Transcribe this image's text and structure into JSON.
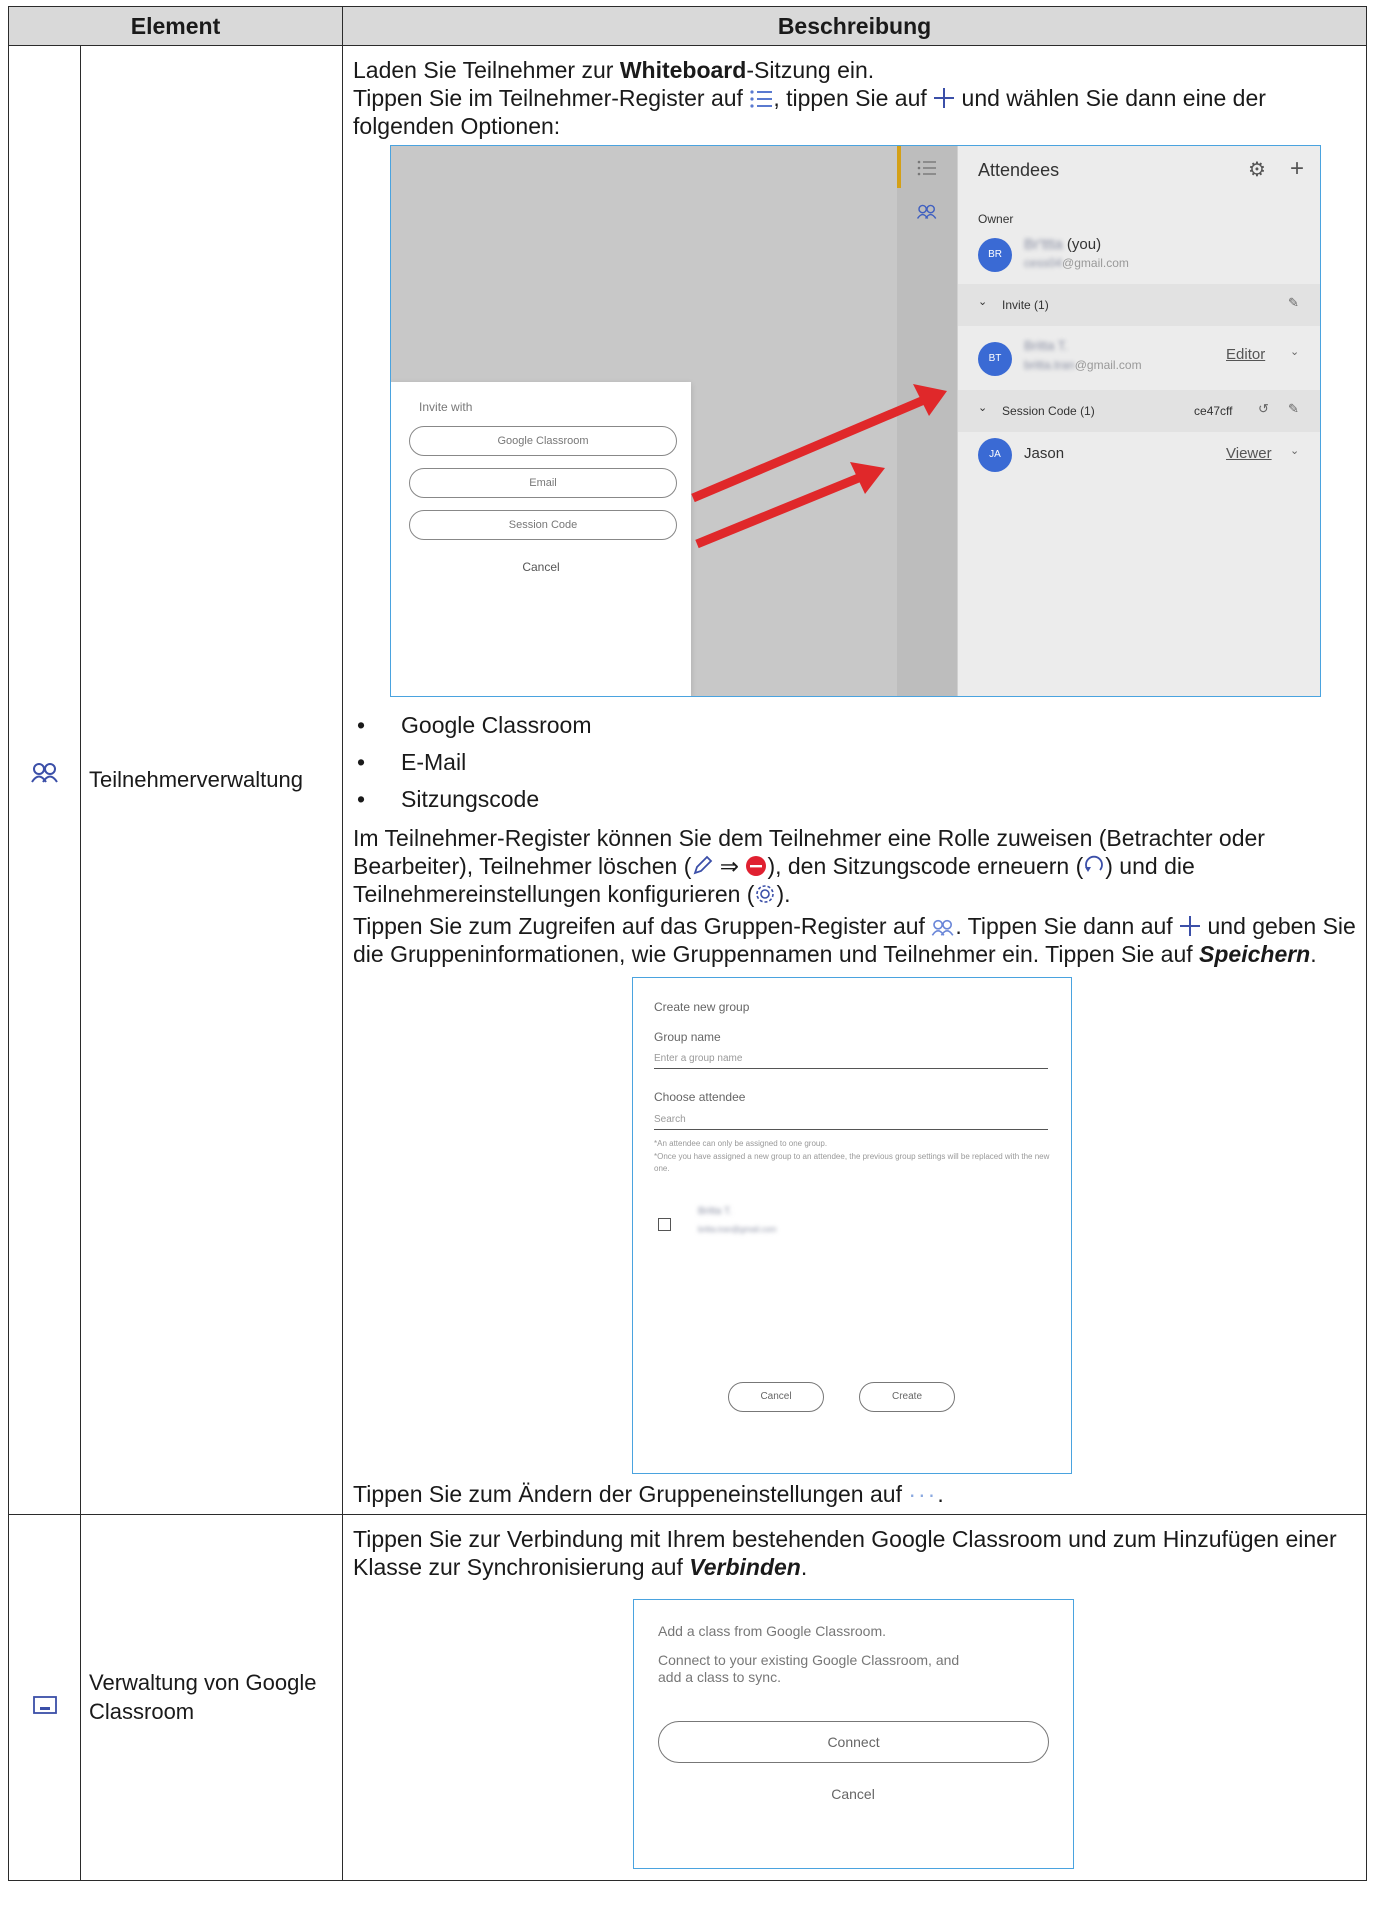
{
  "table": {
    "header": {
      "element": "Element",
      "description": "Beschreibung"
    },
    "rows": [
      {
        "icon": "attendees-icon",
        "name": "Teilnehmerverwaltung",
        "intro_pre": "Laden Sie Teilnehmer zur ",
        "intro_bold": "Whiteboard",
        "intro_post": "-Sitzung ein.",
        "tap_a": "Tippen Sie im Teilnehmer-Register auf ",
        "tap_b": ", tippen Sie auf ",
        "tap_c": " und wählen Sie dann eine der folgenden Optionen:",
        "options": [
          "Google Classroom",
          "E-Mail",
          "Sitzungscode"
        ],
        "roles_a": "Im Teilnehmer-Register können Sie dem Teilnehmer eine Rolle zuweisen (Betrachter oder Bearbeiter), Teilnehmer löschen (",
        "roles_arrow": " ⇒ ",
        "roles_b": "), den Sitzungscode erneuern (",
        "roles_c": ") und die Teilnehmereinstellungen konfigurieren (",
        "roles_d": ").",
        "group_a": "Tippen Sie zum Zugreifen auf das Gruppen-Register auf ",
        "group_b": ". Tippen Sie dann auf ",
        "group_c": " und geben Sie die Gruppeninformationen, wie Gruppennamen und Teilnehmer ein. Tippen Sie auf ",
        "group_bold": "Speichern",
        "group_end": ".",
        "settings_a": "Tippen Sie zum Ändern der Gruppeneinstellungen auf ",
        "settings_b": "."
      },
      {
        "icon": "classroom-icon",
        "name": "Verwaltung von Google Classroom",
        "text_a": "Tippen Sie zur Verbindung mit Ihrem bestehenden Google Classroom und zum Hinzufügen einer Klasse zur Synchronisierung auf ",
        "text_bold": "Verbinden",
        "text_end": "."
      }
    ]
  },
  "shot1": {
    "panel_title": "Attendees",
    "owner_label": "Owner",
    "owner_initials": "BR",
    "owner_name_blur": "Br'ttta",
    "owner_suffix": " (you)",
    "owner_email_blur": "cess04",
    "owner_email_suffix": "@gmail.com",
    "invite_label": "Invite (1)",
    "invitee_initials": "BT",
    "invitee_name_blur": "Britta T.",
    "invitee_email_blur": "britta.tran",
    "invitee_email_suffix": "@gmail.com",
    "invitee_role": "Editor",
    "session_label": "Session Code (1)",
    "session_code": "ce47cff",
    "viewer_initials": "JA",
    "viewer_name": "Jason",
    "viewer_role": "Viewer",
    "dialog_title": "Invite with",
    "dialog_options": [
      "Google Classroom",
      "Email",
      "Session Code"
    ],
    "dialog_cancel": "Cancel"
  },
  "shot2": {
    "title": "Create new group",
    "group_name_label": "Group name",
    "group_name_placeholder": "Enter a group name",
    "choose_label": "Choose attendee",
    "search_placeholder": "Search",
    "note1": "*An attendee can only be assigned to one group.",
    "note2": "*Once you have assigned a new group to an attendee, the previous group settings will be replaced with the new one.",
    "attendee_name_blur": "Britta T.",
    "attendee_email_blur": "britta.tran@gmail.com",
    "cancel": "Cancel",
    "create": "Create"
  },
  "shot3": {
    "title": "Add a class from Google Classroom.",
    "text": "Connect to your existing Google Classroom, and add a class to sync.",
    "connect": "Connect",
    "cancel": "Cancel"
  },
  "colors": {
    "arrow": "#e0282a",
    "frame": "#4aa3df",
    "icon": "#3b4fa8",
    "avatar": "#3a6ad4",
    "delete": "#e02030"
  }
}
